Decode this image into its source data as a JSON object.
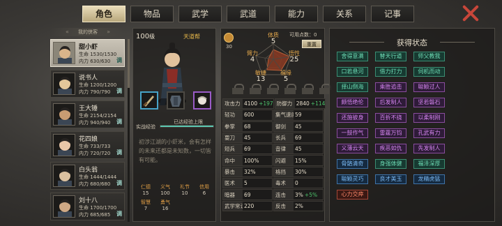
{
  "tabs": [
    {
      "label": "角色",
      "active": true,
      "dot": false
    },
    {
      "label": "物品",
      "active": false,
      "dot": false
    },
    {
      "label": "武学",
      "active": false,
      "dot": false
    },
    {
      "label": "武道",
      "active": false,
      "dot": true
    },
    {
      "label": "能力",
      "active": false,
      "dot": false
    },
    {
      "label": "关系",
      "active": false,
      "dot": false
    },
    {
      "label": "记事",
      "active": false,
      "dot": false
    }
  ],
  "roster": {
    "title": "我的侠客",
    "members": [
      {
        "name": "甜小虾",
        "hp": "生命 1530/1530",
        "mp": "内力 630/630",
        "tune": "调",
        "active": true
      },
      {
        "name": "说书人",
        "hp": "生命 1200/1200",
        "mp": "内力 790/790",
        "tune": "调",
        "active": false
      },
      {
        "name": "王大锤",
        "hp": "生命 2154/2154",
        "mp": "内力 940/940",
        "tune": "调",
        "active": false
      },
      {
        "name": "花四娘",
        "hp": "生命 733/733",
        "mp": "内力 720/720",
        "tune": "调",
        "active": false
      },
      {
        "name": "白头翁",
        "hp": "生命 1444/1444",
        "mp": "内力 680/680",
        "tune": "调",
        "active": false
      },
      {
        "name": "刘十八",
        "hp": "生命 1700/1700",
        "mp": "内力 685/685",
        "tune": "调",
        "active": false
      }
    ]
  },
  "character": {
    "level": "100",
    "level_unit": "级",
    "faction": "天道帮",
    "exp_label": "实战经验",
    "exp_max_label": "已达经验上限",
    "exp_fraction": 1.0,
    "bio": "初涉江湖的小虾米，会有怎样的未来还都是未知数，一切皆有可能。",
    "virtues": [
      {
        "key": "仁德",
        "value": "15"
      },
      {
        "key": "义气",
        "value": "100"
      },
      {
        "key": "礼节",
        "value": "10"
      },
      {
        "key": "信用",
        "value": "6"
      },
      {
        "key": "智慧",
        "value": "7"
      },
      {
        "key": "勇气",
        "value": "16"
      }
    ]
  },
  "attributes": {
    "points_label": "可用点数：0",
    "reset_label": "重置",
    "coin_value": "30",
    "radar": [
      {
        "key": "体质",
        "value": "5"
      },
      {
        "key": "臂力",
        "value": "4"
      },
      {
        "key": "悟性",
        "value": "25"
      },
      {
        "key": "敏捷",
        "value": "13"
      },
      {
        "key": "福缘",
        "value": "5"
      }
    ],
    "stats": [
      [
        {
          "k": "攻击力",
          "v": "4100",
          "bonus": "+197"
        },
        {
          "k": "防御力",
          "v": "2840",
          "bonus": "+114"
        }
      ],
      [
        {
          "k": "轻功",
          "v": "600",
          "bonus": ""
        },
        {
          "k": "集气速度",
          "v": "59",
          "bonus": ""
        }
      ],
      [
        {
          "k": "拳掌",
          "v": "68",
          "bonus": ""
        },
        {
          "k": "御剑",
          "v": "45",
          "bonus": ""
        }
      ],
      [
        {
          "k": "耍刀",
          "v": "45",
          "bonus": ""
        },
        {
          "k": "长兵",
          "v": "69",
          "bonus": ""
        }
      ],
      [
        {
          "k": "短兵",
          "v": "69",
          "bonus": ""
        },
        {
          "k": "音律",
          "v": "45",
          "bonus": ""
        }
      ],
      [
        {
          "k": "命中",
          "v": "100%",
          "bonus": ""
        },
        {
          "k": "闪避",
          "v": "15%",
          "bonus": ""
        }
      ],
      [
        {
          "k": "暴击",
          "v": "32%",
          "bonus": ""
        },
        {
          "k": "格挡",
          "v": "30%",
          "bonus": ""
        }
      ],
      [
        {
          "k": "医术",
          "v": "5",
          "bonus": ""
        },
        {
          "k": "毒术",
          "v": "0",
          "bonus": ""
        }
      ],
      [
        {
          "k": "暗器",
          "v": "69",
          "bonus": ""
        },
        {
          "k": "连击",
          "v": "3%",
          "bonus": "+5%"
        }
      ],
      [
        {
          "k": "武学常识",
          "v": "220",
          "bonus": ""
        },
        {
          "k": "反击",
          "v": "2%",
          "bonus": ""
        }
      ]
    ]
  },
  "status": {
    "title": "获得状态",
    "chips": [
      {
        "label": "舍得意满",
        "color": "green"
      },
      {
        "label": "替天行道",
        "color": "green"
      },
      {
        "label": "师父教我",
        "color": "green"
      },
      {
        "label": "口若悬河",
        "color": "green"
      },
      {
        "label": "借力打力",
        "color": "green"
      },
      {
        "label": "伺机而动",
        "color": "green"
      },
      {
        "label": "择山倒海",
        "color": "green"
      },
      {
        "label": "乘胜追击",
        "color": "purple"
      },
      {
        "label": "聪颖过人",
        "color": "purple"
      },
      {
        "label": "颇悟绝伦",
        "color": "purple"
      },
      {
        "label": "后发制人",
        "color": "purple"
      },
      {
        "label": "坚若磐石",
        "color": "purple"
      },
      {
        "label": "还施彼身",
        "color": "purple"
      },
      {
        "label": "百折不挠",
        "color": "purple"
      },
      {
        "label": "以柔制刚",
        "color": "purple"
      },
      {
        "label": "一鼓作气",
        "color": "purple"
      },
      {
        "label": "雷霆万钧",
        "color": "purple"
      },
      {
        "label": "孔武有力",
        "color": "purple"
      },
      {
        "label": "义薄云天",
        "color": "purple"
      },
      {
        "label": "疾恶如仇",
        "color": "purple"
      },
      {
        "label": "先发制人",
        "color": "purple"
      },
      {
        "label": "骨骼清奇",
        "color": "blue"
      },
      {
        "label": "身强体健",
        "color": "green"
      },
      {
        "label": "福泽深厚",
        "color": "green"
      },
      {
        "label": "聪颖灵巧",
        "color": "blue"
      },
      {
        "label": "良才美玉",
        "color": "blue"
      },
      {
        "label": "龙精虎猛",
        "color": "blue"
      },
      {
        "label": "心力交瘁",
        "color": "red"
      }
    ]
  },
  "colors": {
    "accent_gold": "#e0a54a",
    "bonus_green": "#4cc26b",
    "exp_fill": "#5cc8b2",
    "close_red": "#c8463a"
  },
  "icons": [
    "close-icon",
    "coin-icon",
    "lock-icon",
    "weapon-slot-icon",
    "armor-slot-icon",
    "accessory-slot-icon"
  ]
}
